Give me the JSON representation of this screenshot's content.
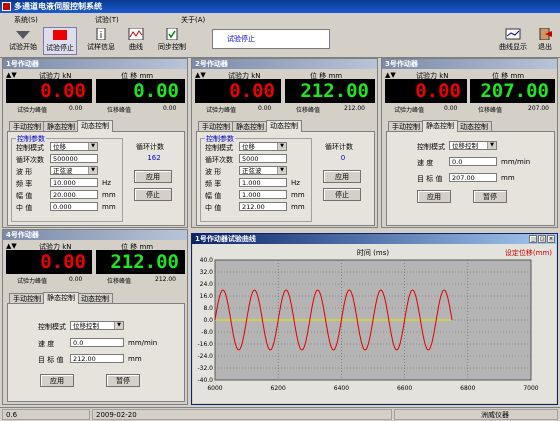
{
  "window": {
    "title": "多通道电液伺服控制系统"
  },
  "menu": [
    "系统(S)",
    "试验(T)",
    "关于(A)"
  ],
  "toolbar": {
    "buttons": [
      "试验开始",
      "试验停止",
      "试样信息",
      "曲线",
      "同步控制"
    ],
    "status": "试验停止",
    "right_buttons": [
      "曲线显示",
      "退出"
    ]
  },
  "common": {
    "force_label": "试验力 kN",
    "disp_label": "位 移 mm",
    "force_peak_label": "试验力峰值",
    "disp_peak_label": "位移峰值",
    "tabs": [
      "手动控制",
      "静态控制",
      "动态控制"
    ]
  },
  "actuator1": {
    "title": "1号作动器",
    "force": "0.00",
    "disp": "0.00",
    "force_peak": "0.00",
    "disp_peak": "0.00",
    "params_title": "控制参数",
    "rows": [
      {
        "label": "控制模式",
        "value": "位移"
      },
      {
        "label": "循环次数",
        "value": "500000"
      },
      {
        "label": "波    形",
        "value": "正弦波"
      },
      {
        "label": "频    率",
        "value": "10.000",
        "unit": "Hz"
      },
      {
        "label": "幅    值",
        "value": "20.000",
        "unit": "mm"
      },
      {
        "label": "中    值",
        "value": "0.000",
        "unit": "mm"
      }
    ],
    "count_label": "循环计数",
    "count": "162",
    "apply": "应用",
    "stop": "停止"
  },
  "actuator2": {
    "title": "2号作动器",
    "force": "0.00",
    "disp": "212.00",
    "force_peak": "0.00",
    "disp_peak": "212.00",
    "params_title": "控制参数",
    "rows": [
      {
        "label": "控制模式",
        "value": "位移"
      },
      {
        "label": "循环次数",
        "value": "5000"
      },
      {
        "label": "波    形",
        "value": "正弦波"
      },
      {
        "label": "频    率",
        "value": "1.000",
        "unit": "Hz"
      },
      {
        "label": "幅    值",
        "value": "1.000",
        "unit": "mm"
      },
      {
        "label": "中    值",
        "value": "212.00",
        "unit": "mm"
      }
    ],
    "count_label": "循环计数",
    "count": "0",
    "apply": "应用",
    "stop": "停止"
  },
  "actuator3": {
    "title": "3号作动器",
    "force": "0.00",
    "disp": "207.00",
    "force_peak": "0.00",
    "disp_peak": "207.00",
    "mode_label": "控制模式",
    "mode": "位移控制",
    "speed_label": "速    度",
    "speed": "0.0",
    "speed_unit": "mm/min",
    "target_label": "目 标 值",
    "target": "207.00",
    "target_unit": "mm",
    "apply": "应用",
    "pause": "暂停"
  },
  "actuator4": {
    "title": "4号作动器",
    "force": "0.00",
    "disp": "212.00",
    "force_peak": "0.00",
    "disp_peak": "212.00",
    "mode_label": "控制模式",
    "mode": "位移控制",
    "speed_label": "速    度",
    "speed": "0.0",
    "speed_unit": "mm/min",
    "target_label": "目 标 值",
    "target": "212.00",
    "target_unit": "mm",
    "apply": "应用",
    "pause": "暂停"
  },
  "curve_window": {
    "title": "1号作动器试验曲线",
    "xlabel": "时间 (ms)",
    "legend": "设定位移(mm)",
    "colors": {
      "actual": "#e00000",
      "setpoint": "#e8e800"
    }
  },
  "chart_data": {
    "type": "line",
    "title": "",
    "xlabel": "时间 (ms)",
    "ylabel": "",
    "xlim": [
      6000,
      7000
    ],
    "ylim": [
      -40,
      40
    ],
    "x_ticks": [
      "6000",
      "6200",
      "6400",
      "6600",
      "6800",
      "7000"
    ],
    "y_ticks": [
      "40.0",
      "32.0",
      "24.0",
      "16.0",
      "8.0",
      "0.0",
      "-8.0",
      "-16.0",
      "-24.0",
      "-32.0",
      "-40.0"
    ],
    "grid": true,
    "series": [
      {
        "name": "设定位移(mm)",
        "color": "#e8e800",
        "x": [
          6000,
          6750
        ],
        "y": [
          0,
          0
        ]
      },
      {
        "name": "",
        "color": "#e00000",
        "amplitude": 20,
        "frequency_hz": 10,
        "x_range": [
          6000,
          6750
        ]
      }
    ]
  },
  "statusbar": {
    "cell1": "0.6",
    "date": "2009-02-20",
    "company": "洲威仪器"
  }
}
